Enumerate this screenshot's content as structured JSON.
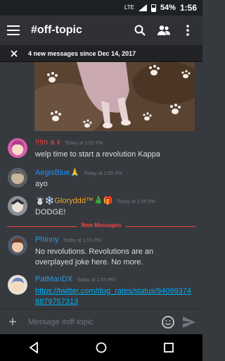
{
  "status_bar": {
    "battery": "54%",
    "time": "1:56",
    "network": "LTE"
  },
  "app_bar": {
    "channel_title": "#off-topic"
  },
  "banner": {
    "text": "4 new messages since Dec 14, 2017"
  },
  "messages": [
    {
      "author": "!!!m a x",
      "author_color": "#f04747",
      "timestamp": "Today at 1:55 PM",
      "text": "welp time to start a revolution Kappa"
    },
    {
      "author": "AegisBlue🙏",
      "author_color": "#1e90ff",
      "timestamp": "Today at 1:55 PM",
      "text": "ayo"
    },
    {
      "author": "☃️❄️Gloryddd™🎄🎁",
      "author_color": "#f5a623",
      "timestamp": "Today at 1:55 PM",
      "text": "DODGE!"
    },
    {
      "author": "Phinny",
      "author_color": "#3498db",
      "timestamp": "Today at 1:55 PM",
      "text": "No revolutions. Revolutions are an overplayed joke here. No more."
    },
    {
      "author": "PatManDX",
      "author_color": "#3498db",
      "timestamp": "Today at 1:55 PM",
      "link": "https://twitter.com/dog_rates/status/940993748879757313"
    }
  ],
  "divider": {
    "label": "New Messages"
  },
  "composer": {
    "placeholder": "Message #off-topic"
  },
  "colors": {
    "accent": "#7289da",
    "new_messages": "#f04747",
    "background": "#36393e"
  }
}
